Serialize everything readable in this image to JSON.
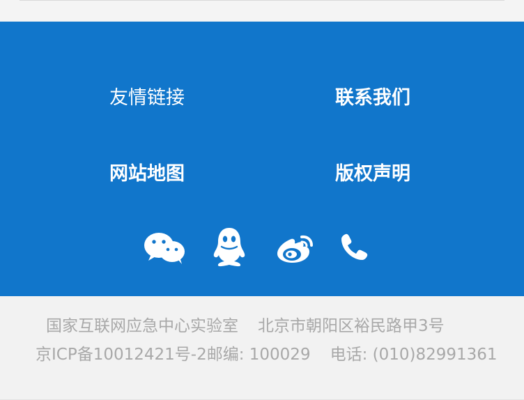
{
  "footer_links": {
    "friends": "友情链接",
    "contact": "联系我们",
    "sitemap": "网站地图",
    "copyright": "版权声明"
  },
  "social": {
    "icons": [
      "wechat-icon",
      "qq-icon",
      "weibo-icon",
      "phone-icon"
    ]
  },
  "footer": {
    "organization": "国家互联网应急中心实验室",
    "address": "北京市朝阳区裕民路甲3号",
    "icp": "京ICP备10012421号-2",
    "postcode": "邮编: 100029",
    "phone": "电话: (010)82991361"
  },
  "colors": {
    "panel": "#1176cb",
    "footer_text": "#a8a8a8",
    "background": "#f2f2f2"
  }
}
